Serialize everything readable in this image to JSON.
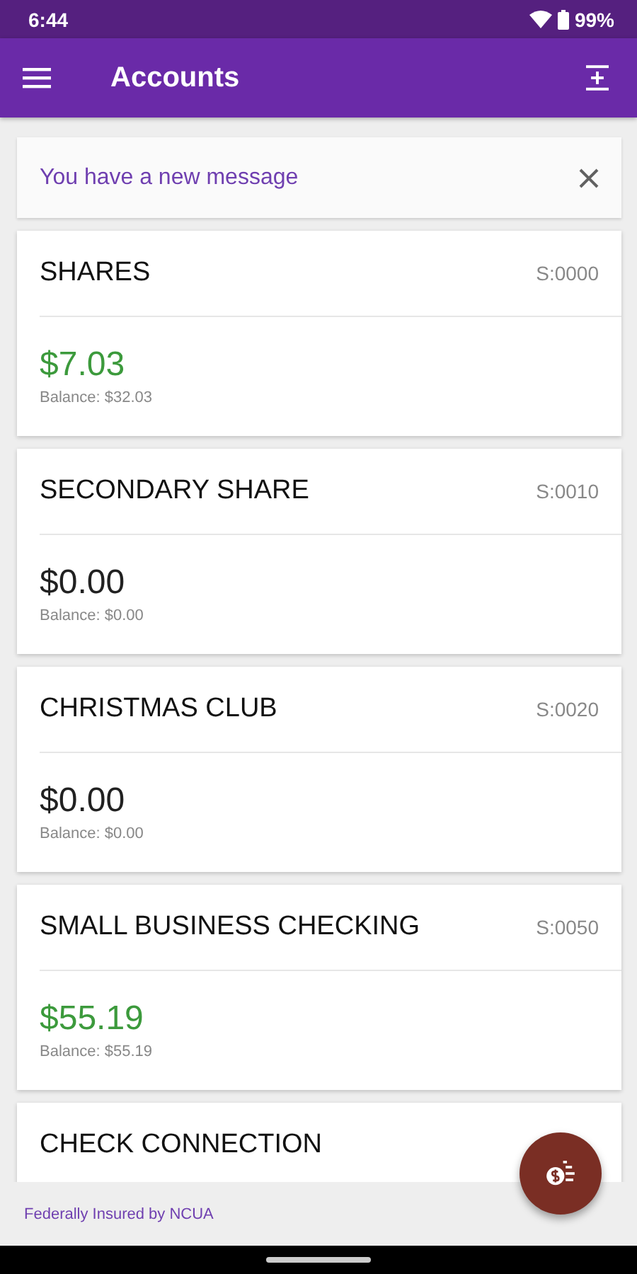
{
  "status_bar": {
    "time": "6:44",
    "battery": "99%"
  },
  "app_bar": {
    "title": "Accounts"
  },
  "message": {
    "text": "You have a new message"
  },
  "accounts": [
    {
      "name": "SHARES",
      "number": "S:0000",
      "amount": "$7.03",
      "balance": "Balance: $32.03",
      "color": "#3c9a3c"
    },
    {
      "name": "SECONDARY SHARE",
      "number": "S:0010",
      "amount": "$0.00",
      "balance": "Balance: $0.00",
      "color": "#212121"
    },
    {
      "name": "CHRISTMAS CLUB",
      "number": "S:0020",
      "amount": "$0.00",
      "balance": "Balance: $0.00",
      "color": "#212121"
    },
    {
      "name": "SMALL BUSINESS CHECKING",
      "number": "S:0050",
      "amount": "$55.19",
      "balance": "Balance: $55.19",
      "color": "#3c9a3c"
    },
    {
      "name": "CHECK CONNECTION"
    }
  ],
  "footer": {
    "text": "Federally Insured by NCUA"
  }
}
